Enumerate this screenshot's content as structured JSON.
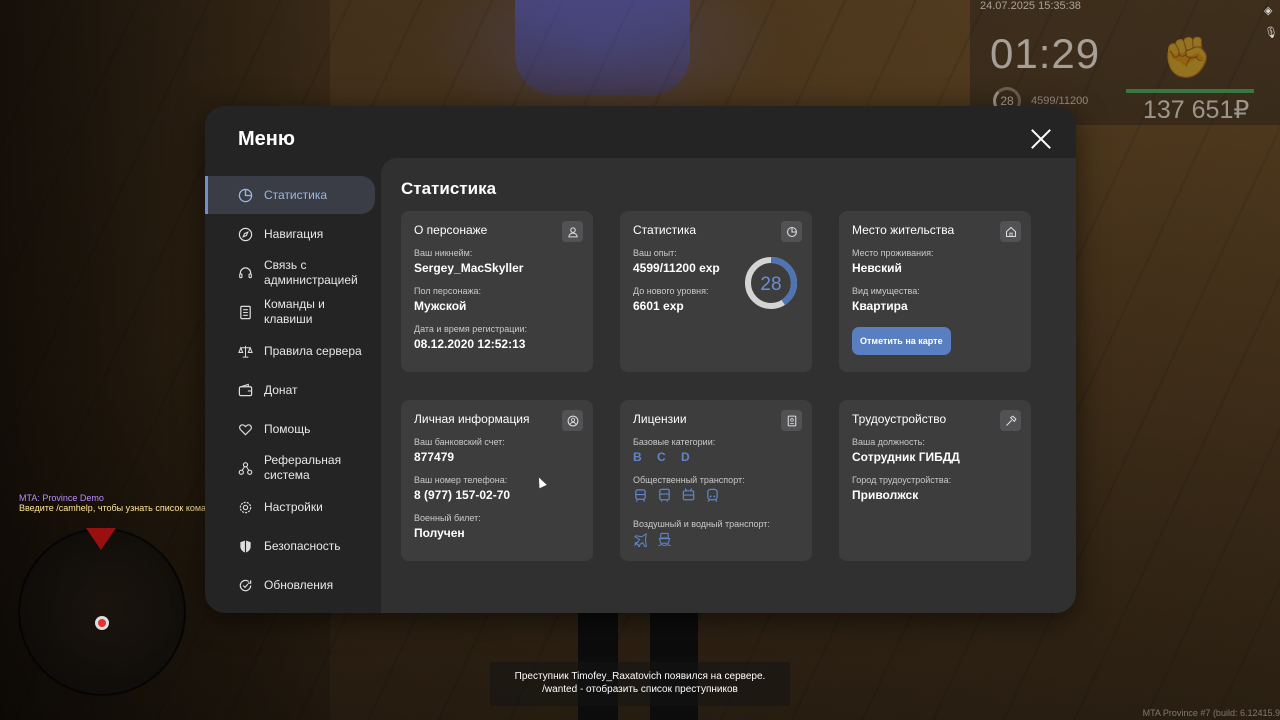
{
  "hud": {
    "datetime": "24.07.2025 15:35:38",
    "clock": "01:29",
    "level": "28",
    "exp": "4599/11200",
    "money": "137 651₽"
  },
  "chat": {
    "line1": "MTA: Province Demo",
    "line2": "Введите /camhelp, чтобы узнать список команд для работы с камерой."
  },
  "notification": {
    "line1": "Преступник Timofey_Raxatovich появился на сервере.",
    "line2": "/wanted - отобразить список преступников"
  },
  "build": "MTA Province #7 (build: 6.12415.9",
  "menu": {
    "title": "Меню",
    "sidebar": [
      {
        "label": "Статистика",
        "icon": "pie-chart-icon"
      },
      {
        "label": "Навигация",
        "icon": "compass-icon"
      },
      {
        "label": "Связь с администрацией",
        "icon": "headset-icon"
      },
      {
        "label": "Команды и клавиши",
        "icon": "document-icon"
      },
      {
        "label": "Правила сервера",
        "icon": "scales-icon"
      },
      {
        "label": "Донат",
        "icon": "wallet-icon"
      },
      {
        "label": "Помощь",
        "icon": "heart-hand-icon"
      },
      {
        "label": "Реферальная система",
        "icon": "network-icon"
      },
      {
        "label": "Настройки",
        "icon": "gear-icon"
      },
      {
        "label": "Безопасность",
        "icon": "shield-icon"
      },
      {
        "label": "Обновления",
        "icon": "refresh-check-icon"
      }
    ],
    "active_index": 0
  },
  "content": {
    "title": "Статистика",
    "character": {
      "title": "О персонаже",
      "nickname_label": "Ваш никнейм:",
      "nickname": "Sergey_MacSkyller",
      "gender_label": "Пол персонажа:",
      "gender": "Мужской",
      "reg_label": "Дата и время регистрации:",
      "reg_value": "08.12.2020 12:52:13"
    },
    "stats": {
      "title": "Статистика",
      "exp_label": "Ваш опыт:",
      "exp_value": "4599/11200 exp",
      "next_label": "До нового уровня:",
      "next_value": "6601 exp",
      "level": "28",
      "progress": 0.41
    },
    "residence": {
      "title": "Место жительства",
      "place_label": "Место проживания:",
      "place": "Невский",
      "type_label": "Вид имущества:",
      "type": "Квартира",
      "button": "Отметить на карте"
    },
    "personal": {
      "title": "Личная информация",
      "bank_label": "Ваш банковский счет:",
      "bank": "877479",
      "phone_label": "Ваш номер телефона:",
      "phone": "8 (977) 157-02-70",
      "military_label": "Военный билет:",
      "military": "Получен"
    },
    "licenses": {
      "title": "Лицензии",
      "basic_label": "Базовые категории:",
      "basic": "B C D",
      "public_label": "Общественный транспорт:",
      "air_label": "Воздушный и водный транспорт:"
    },
    "employment": {
      "title": "Трудоустройство",
      "position_label": "Ваша должность:",
      "position": "Сотрудник ГИБДД",
      "city_label": "Город трудоустройства:",
      "city": "Приволжск"
    }
  },
  "colors": {
    "accent": "#5a7fc0",
    "panel": "#242425",
    "card": "#3d3d3e"
  }
}
